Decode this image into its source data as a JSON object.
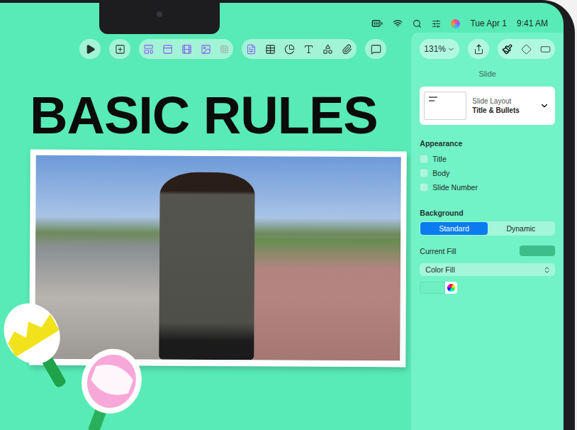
{
  "menubar": {
    "date": "Tue Apr 1",
    "time": "9:41 AM"
  },
  "toolbar": {
    "zoom": "131%",
    "inspector_tabs": [
      {
        "selected": true
      },
      {
        "selected": false
      },
      {
        "selected": false
      }
    ]
  },
  "slide": {
    "title": "BASIC RULES"
  },
  "inspector": {
    "header": "Slide",
    "layout": {
      "label": "Slide Layout",
      "value": "Title & Bullets"
    },
    "appearance": {
      "title": "Appearance",
      "options": [
        {
          "label": "Title",
          "checked": false
        },
        {
          "label": "Body",
          "checked": false
        },
        {
          "label": "Slide Number",
          "checked": false
        }
      ]
    },
    "background": {
      "title": "Background",
      "modes": [
        {
          "label": "Standard",
          "selected": true
        },
        {
          "label": "Dynamic",
          "selected": false
        }
      ],
      "current_fill": {
        "label": "Current Fill",
        "color": "#3dbd89"
      },
      "fill_type": "Color Fill",
      "color_well": {
        "color": "#6ef0c2"
      }
    }
  }
}
